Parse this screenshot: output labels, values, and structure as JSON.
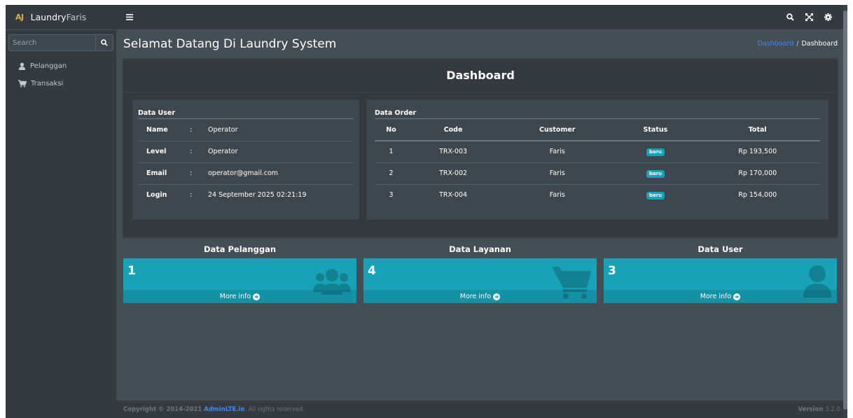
{
  "brand": {
    "logo": "AJ",
    "name_main": "Laundry",
    "name_thin": "Faris"
  },
  "sidebar": {
    "search": {
      "placeholder": "Search",
      "value": ""
    },
    "items": [
      {
        "label": "Pelanggan",
        "icon": "user-icon"
      },
      {
        "label": "Transaksi",
        "icon": "cart-icon"
      }
    ]
  },
  "topbar": {
    "icons": [
      "menu-icon",
      "search-icon",
      "expand-icon",
      "gear-icon"
    ]
  },
  "header": {
    "title": "Selamat Datang Di Laundry System",
    "breadcrumb": {
      "link": "Dashboard",
      "separator": "/",
      "current": "Dashboard"
    }
  },
  "dashboard": {
    "title": "Dashboard",
    "user_card": {
      "title": "Data User",
      "rows": [
        {
          "key": "Name",
          "sep": ":",
          "value": "Operator"
        },
        {
          "key": "Level",
          "sep": ":",
          "value": "Operator"
        },
        {
          "key": "Email",
          "sep": ":",
          "value": "operator@gmail.com"
        },
        {
          "key": "Login",
          "sep": ":",
          "value": "24 September 2025 02:21:19"
        }
      ]
    },
    "order_card": {
      "title": "Data Order",
      "columns": [
        "No",
        "Code",
        "Customer",
        "Status",
        "Total"
      ],
      "rows": [
        {
          "no": "1",
          "code": "TRX-003",
          "customer": "Faris",
          "status": "baru",
          "total": "Rp 193,500"
        },
        {
          "no": "2",
          "code": "TRX-002",
          "customer": "Faris",
          "status": "baru",
          "total": "Rp 170,000"
        },
        {
          "no": "3",
          "code": "TRX-004",
          "customer": "Faris",
          "status": "baru",
          "total": "Rp 154,000"
        }
      ]
    }
  },
  "stats": [
    {
      "title": "Data Pelanggan",
      "value": "1",
      "more": "More info",
      "icon": "users-icon"
    },
    {
      "title": "Data Layanan",
      "value": "4",
      "more": "More info",
      "icon": "cart-icon"
    },
    {
      "title": "Data User",
      "value": "3",
      "more": "More info",
      "icon": "user-icon"
    }
  ],
  "footer": {
    "copyright_prefix": "Copyright © 2014-2021 ",
    "link": "AdminLTE.io",
    "suffix": ". All rights reserved.",
    "version_label": "Version",
    "version_number": "3.2.0"
  },
  "colors": {
    "accent": "#17a2b8",
    "link": "#3f8af5",
    "sidebar_bg": "#343a40",
    "content_bg": "#454d55",
    "logo": "#e0b12c"
  }
}
